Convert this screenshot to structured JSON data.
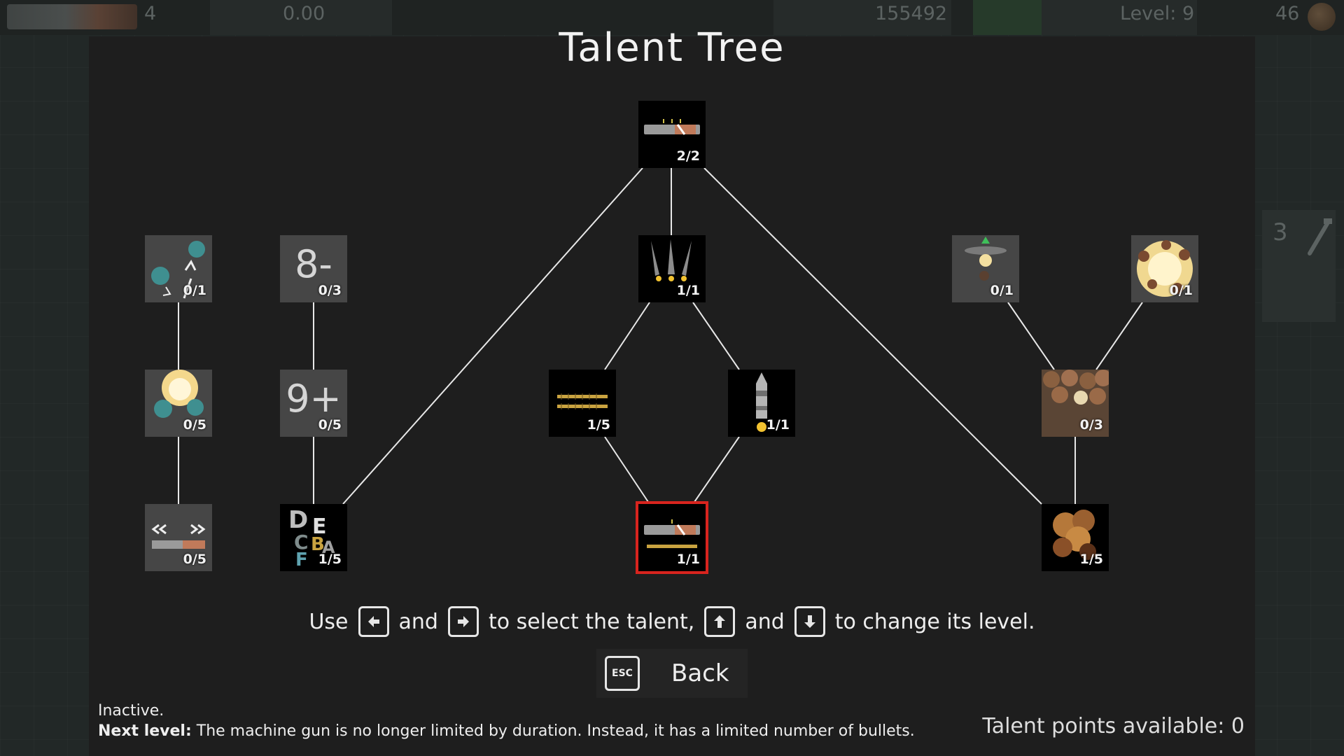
{
  "hud": {
    "lives": "4",
    "timer": "0.00",
    "score": "155492",
    "level": "Level: 9",
    "coins": "46"
  },
  "side_card": {
    "count": "3",
    "icon": "wrench-icon"
  },
  "title": "Talent Tree",
  "nodes": [
    {
      "id": "root",
      "level": "2/2",
      "state": "active",
      "icon": "machine-gun-icon"
    },
    {
      "id": "triple-shot",
      "level": "1/1",
      "state": "active",
      "icon": "triple-rocket-icon"
    },
    {
      "id": "bullet-belt",
      "level": "1/5",
      "state": "active",
      "icon": "bullet-belt-icon"
    },
    {
      "id": "rocket",
      "level": "1/1",
      "state": "active",
      "icon": "rocket-icon"
    },
    {
      "id": "limited-bullets",
      "level": "1/1",
      "state": "selected",
      "icon": "gun-with-ammo-icon"
    },
    {
      "id": "dodge-orbs",
      "level": "0/1",
      "state": "locked",
      "icon": "orbs-arrows-icon"
    },
    {
      "id": "explosion-orbs",
      "level": "0/5",
      "state": "locked",
      "icon": "explosion-orbs-icon"
    },
    {
      "id": "speed",
      "level": "0/5",
      "state": "locked",
      "icon": "speed-arrows-icon"
    },
    {
      "id": "minus-eight",
      "level": "0/3",
      "state": "locked",
      "glyph": "8-"
    },
    {
      "id": "plus-nine",
      "level": "0/5",
      "state": "locked",
      "glyph": "9+"
    },
    {
      "id": "letters",
      "level": "1/5",
      "state": "active",
      "icon": "letters-icon"
    },
    {
      "id": "ufo",
      "level": "0/1",
      "state": "locked",
      "icon": "ufo-icon"
    },
    {
      "id": "big-blast",
      "level": "0/1",
      "state": "locked",
      "icon": "big-explosion-icon"
    },
    {
      "id": "coin-pile",
      "level": "0/3",
      "state": "locked",
      "icon": "coin-pile-icon"
    },
    {
      "id": "coin-burst",
      "level": "1/5",
      "state": "active",
      "icon": "coin-burst-icon"
    }
  ],
  "instructions": {
    "use": "Use",
    "and1": "and",
    "select": "to select the talent,",
    "and2": "and",
    "change": "to change its level.",
    "keys": [
      "left-arrow-key-icon",
      "right-arrow-key-icon",
      "up-arrow-key-icon",
      "down-arrow-key-icon"
    ]
  },
  "back": {
    "key": "ESC",
    "label": "Back"
  },
  "status": "Inactive.",
  "description": {
    "label": "Next level:",
    "text": " The machine gun is no longer limited by duration. Instead, it has a limited number of bullets."
  },
  "talent_points": "Talent points available: 0",
  "colors": {
    "selected_outline": "#d8241e",
    "locked_tile": "#464646",
    "active_tile": "#000000"
  }
}
